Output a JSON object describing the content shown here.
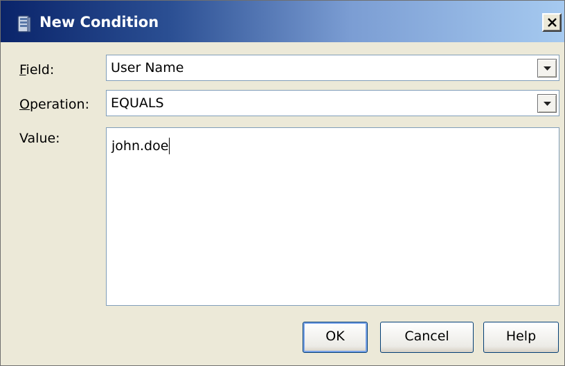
{
  "window": {
    "title": "New Condition",
    "close_symbol": "×",
    "icon": "server-icon",
    "close_icon": "close-icon"
  },
  "form": {
    "field": {
      "label_mnemonic": "F",
      "label_rest": "ield:",
      "value": "User Name"
    },
    "operation": {
      "label_mnemonic": "O",
      "label_rest": "peration:",
      "value": "EQUALS"
    },
    "value": {
      "label": "Value:",
      "text": "john.doe"
    }
  },
  "buttons": {
    "ok": "OK",
    "cancel": "Cancel",
    "help": "Help"
  },
  "colors": {
    "titlebar_start": "#0a246a",
    "titlebar_end": "#a6caf0",
    "dialog_bg": "#ece9d8",
    "input_border": "#7f9db9"
  }
}
